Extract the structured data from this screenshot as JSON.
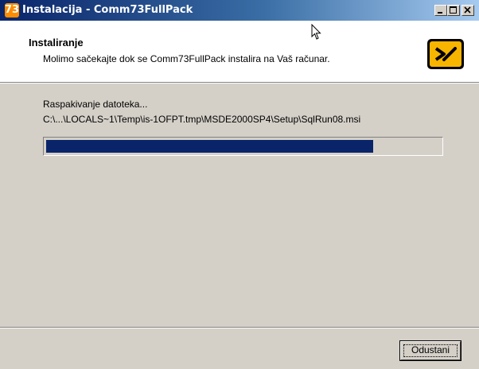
{
  "window": {
    "title": "Instalacija - Comm73FullPack",
    "app_icon_text": "73"
  },
  "header": {
    "title": "Instaliranje",
    "subtitle": "Molimo sačekajte dok se Comm73FullPack instalira na Vaš računar."
  },
  "body": {
    "status": "Raspakivanje datoteka...",
    "file_path": "C:\\...\\LOCALS~1\\Temp\\is-1OFPT.tmp\\MSDE2000SP4\\Setup\\SqlRun08.msi",
    "progress_fraction": 0.83
  },
  "footer": {
    "cancel_label": "Odustani"
  },
  "colors": {
    "title_start": "#0a246a",
    "title_end": "#a6caf0",
    "progress": "#0a246a",
    "icon": "#ff8c00"
  }
}
